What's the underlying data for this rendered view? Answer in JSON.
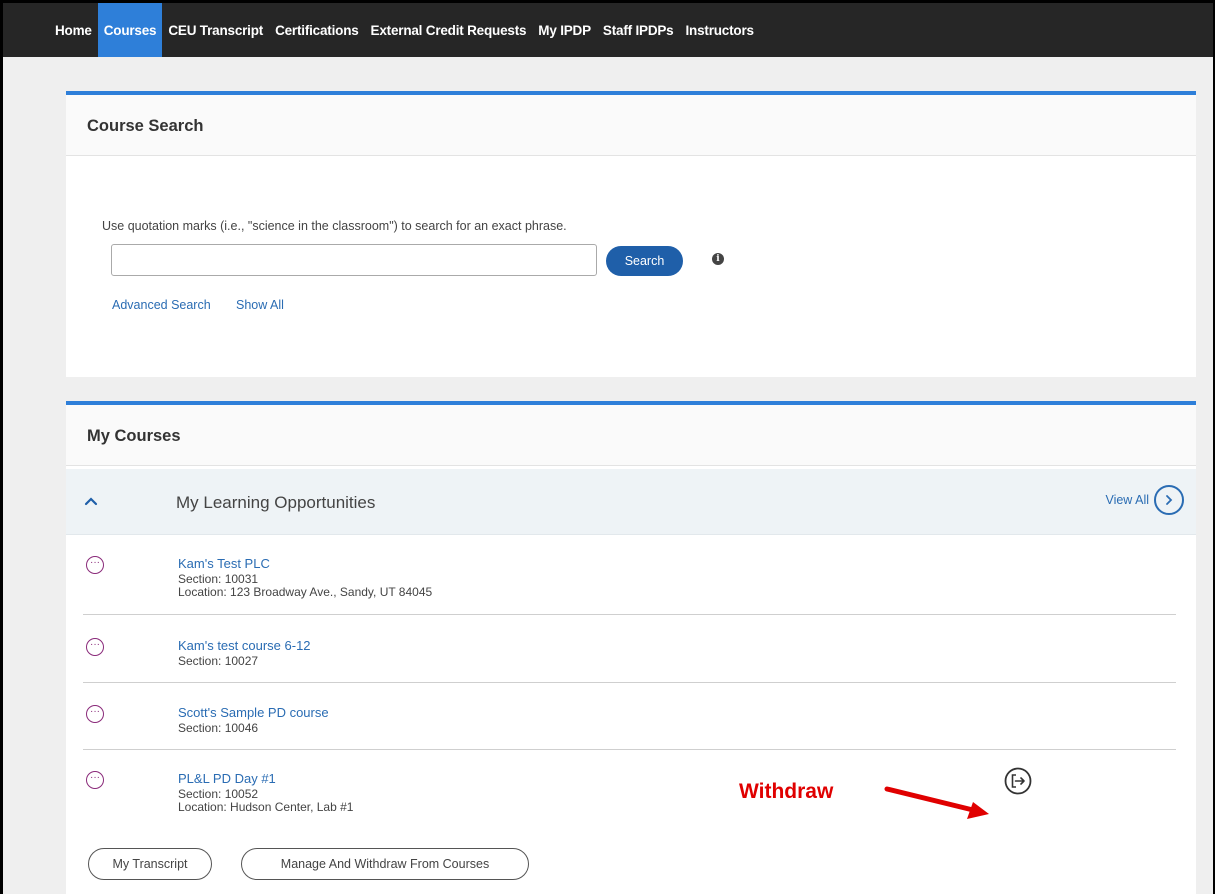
{
  "nav": {
    "items": [
      {
        "label": "Home",
        "active": false
      },
      {
        "label": "Courses",
        "active": true
      },
      {
        "label": "CEU Transcript",
        "active": false
      },
      {
        "label": "Certifications",
        "active": false
      },
      {
        "label": "External Credit Requests",
        "active": false
      },
      {
        "label": "My IPDP",
        "active": false
      },
      {
        "label": "Staff IPDPs",
        "active": false
      },
      {
        "label": "Instructors",
        "active": false
      }
    ]
  },
  "search": {
    "title": "Course Search",
    "hint": "Use quotation marks (i.e., \"science in the classroom\") to search for an exact phrase.",
    "input_value": "",
    "button_label": "Search",
    "advanced_link": "Advanced Search",
    "show_all_link": "Show All"
  },
  "my_courses": {
    "title": "My Courses",
    "section_title": "My Learning Opportunities",
    "view_all": "View All",
    "courses": [
      {
        "title": "Kam's Test PLC",
        "section": "Section: 10031",
        "location": "Location: 123 Broadway Ave., Sandy, UT 84045"
      },
      {
        "title": "Kam's test course 6-12",
        "section": "Section: 10027"
      },
      {
        "title": "Scott's Sample PD course",
        "section": "Section: 10046"
      },
      {
        "title": "PL&L PD Day #1",
        "section": "Section: 10052",
        "location": "Location: Hudson Center, Lab #1"
      }
    ],
    "transcript_button": "My Transcript",
    "manage_button": "Manage And Withdraw From Courses"
  },
  "annotation": {
    "label": "Withdraw"
  },
  "colors": {
    "nav_bg": "#262626",
    "nav_active": "#2e7fd9",
    "panel_accent": "#2e7fd9",
    "button_blue": "#1f5fa9",
    "link_blue": "#2a6cb3",
    "dots_purple": "#8a2a7a",
    "annotation_red": "#e00000"
  }
}
